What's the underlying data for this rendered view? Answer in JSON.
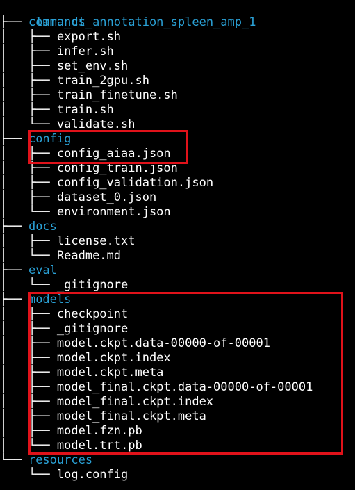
{
  "root": "clara_ct_annotation_spleen_amp_1",
  "colors": {
    "background": "#000000",
    "directory": "#2aa1d6",
    "file": "#ffffff",
    "highlight": "#e0121a"
  },
  "lines": [
    {
      "prefix": "├── ",
      "name": "commands",
      "type": "dir"
    },
    {
      "prefix": "│   ├── ",
      "name": "export.sh",
      "type": "file"
    },
    {
      "prefix": "│   ├── ",
      "name": "infer.sh",
      "type": "file"
    },
    {
      "prefix": "│   ├── ",
      "name": "set_env.sh",
      "type": "file"
    },
    {
      "prefix": "│   ├── ",
      "name": "train_2gpu.sh",
      "type": "file"
    },
    {
      "prefix": "│   ├── ",
      "name": "train_finetune.sh",
      "type": "file"
    },
    {
      "prefix": "│   ├── ",
      "name": "train.sh",
      "type": "file"
    },
    {
      "prefix": "│   └── ",
      "name": "validate.sh",
      "type": "file"
    },
    {
      "prefix": "├── ",
      "name": "config",
      "type": "dir"
    },
    {
      "prefix": "│   ├── ",
      "name": "config_aiaa.json",
      "type": "file"
    },
    {
      "prefix": "│   ├── ",
      "name": "config_train.json",
      "type": "file"
    },
    {
      "prefix": "│   ├── ",
      "name": "config_validation.json",
      "type": "file"
    },
    {
      "prefix": "│   ├── ",
      "name": "dataset_0.json",
      "type": "file"
    },
    {
      "prefix": "│   └── ",
      "name": "environment.json",
      "type": "file"
    },
    {
      "prefix": "├── ",
      "name": "docs",
      "type": "dir"
    },
    {
      "prefix": "│   ├── ",
      "name": "license.txt",
      "type": "file"
    },
    {
      "prefix": "│   └── ",
      "name": "Readme.md",
      "type": "file"
    },
    {
      "prefix": "├── ",
      "name": "eval",
      "type": "dir"
    },
    {
      "prefix": "│   └── ",
      "name": "_gitignore",
      "type": "file"
    },
    {
      "prefix": "├── ",
      "name": "models",
      "type": "dir"
    },
    {
      "prefix": "│   ├── ",
      "name": "checkpoint",
      "type": "file"
    },
    {
      "prefix": "│   ├── ",
      "name": "_gitignore",
      "type": "file"
    },
    {
      "prefix": "│   ├── ",
      "name": "model.ckpt.data-00000-of-00001",
      "type": "file"
    },
    {
      "prefix": "│   ├── ",
      "name": "model.ckpt.index",
      "type": "file"
    },
    {
      "prefix": "│   ├── ",
      "name": "model.ckpt.meta",
      "type": "file"
    },
    {
      "prefix": "│   ├── ",
      "name": "model_final.ckpt.data-00000-of-00001",
      "type": "file"
    },
    {
      "prefix": "│   ├── ",
      "name": "model_final.ckpt.index",
      "type": "file"
    },
    {
      "prefix": "│   ├── ",
      "name": "model_final.ckpt.meta",
      "type": "file"
    },
    {
      "prefix": "│   ├── ",
      "name": "model.fzn.pb",
      "type": "file"
    },
    {
      "prefix": "│   └── ",
      "name": "model.trt.pb",
      "type": "file"
    },
    {
      "prefix": "└── ",
      "name": "resources",
      "type": "dir"
    },
    {
      "prefix": "    └── ",
      "name": "log.config",
      "type": "file"
    }
  ]
}
